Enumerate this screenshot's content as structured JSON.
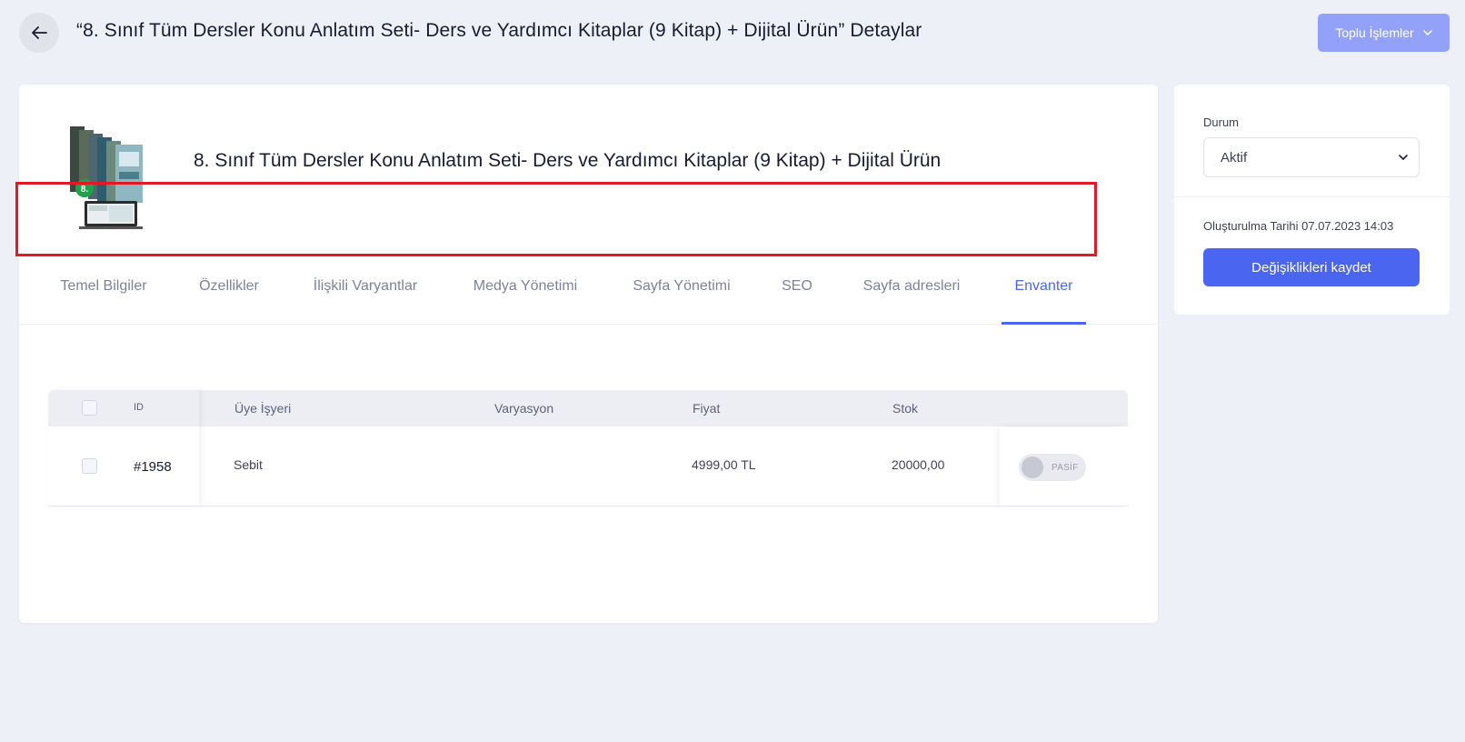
{
  "header": {
    "title": "“8. Sınıf Tüm Dersler Konu Anlatım Seti- Ders ve Yardımcı Kitaplar (9 Kitap) + Dijital Ürün” Detaylar",
    "bulk_actions_label": "Toplu İşlemler"
  },
  "product": {
    "name": "8. Sınıf Tüm Dersler Konu Anlatım Seti- Ders ve Yardımcı Kitaplar (9 Kitap) + Dijital Ürün",
    "badge_text": "8."
  },
  "tabs": [
    {
      "label": "Temel Bilgiler",
      "active": false
    },
    {
      "label": "Özellikler",
      "active": false
    },
    {
      "label": "İlişkili Varyantlar",
      "active": false
    },
    {
      "label": "Medya Yönetimi",
      "active": false
    },
    {
      "label": "Sayfa Yönetimi",
      "active": false
    },
    {
      "label": "SEO",
      "active": false
    },
    {
      "label": "Sayfa adresleri",
      "active": false
    },
    {
      "label": "Envanter",
      "active": true
    }
  ],
  "inventory_table": {
    "columns": {
      "id": "ID",
      "merchant": "Üye İşyeri",
      "variation": "Varyasyon",
      "price": "Fiyat",
      "stock": "Stok"
    },
    "rows": [
      {
        "id": "#1958",
        "merchant": "Sebit",
        "variation": "",
        "price": "4999,00 TL",
        "stock": "20000,00",
        "status_label": "PASİF"
      }
    ]
  },
  "sidebar": {
    "status_label": "Durum",
    "status_value": "Aktif",
    "created_text": "Oluşturulma Tarihi 07.07.2023 14:03",
    "save_label": "Değişiklikleri kaydet"
  },
  "colors": {
    "accent": "#4a66f0",
    "accent_light": "#93a1f8",
    "highlight": "#e01b24",
    "background": "#eef0f8"
  }
}
